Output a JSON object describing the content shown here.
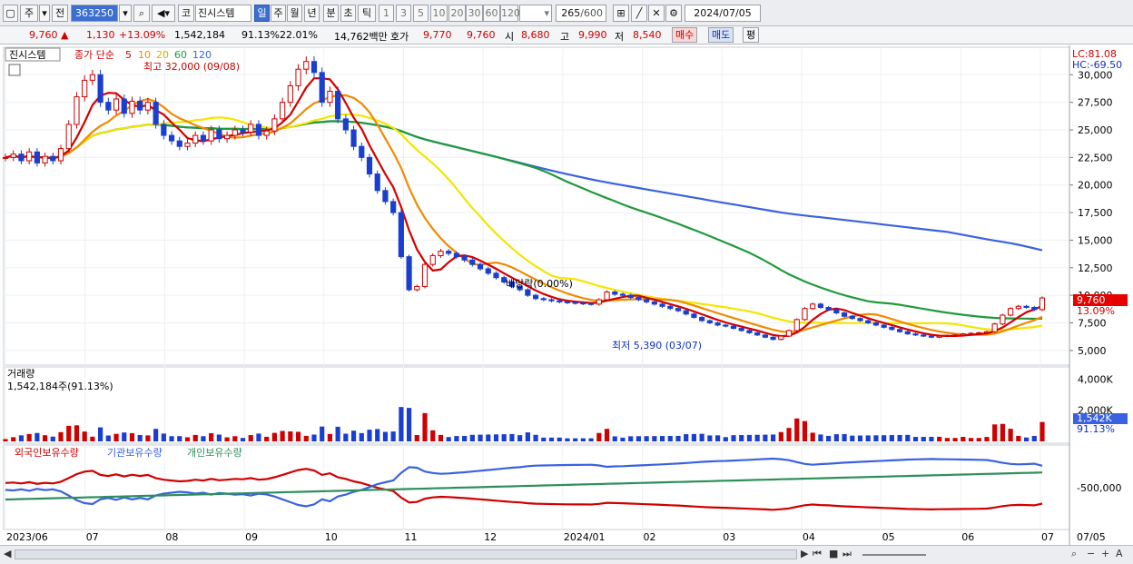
{
  "toolbar": {
    "period_labels": [
      "주",
      "전"
    ],
    "code": "363250",
    "code_type": "코",
    "stock_name": "진시스템",
    "timeframes": [
      "일",
      "주",
      "월",
      "년",
      "분",
      "초",
      "틱"
    ],
    "selected_timeframe": "일",
    "intervals": [
      "1",
      "3",
      "5",
      "10",
      "20",
      "30",
      "60",
      "120"
    ],
    "count": "265",
    "count_max": "/600",
    "date": "2024/07/05"
  },
  "quote": {
    "price": "9,760",
    "change_sign": "▲",
    "change": "1,130",
    "change_pct": "+13.09%",
    "volume": "1,542,184",
    "vol_ratio": "91.13%",
    "turnover": "22.01%",
    "amount": "14,762백만",
    "ask_label": "호가",
    "ask1": "9,770",
    "ask2": "9,760",
    "open_label": "시",
    "open": "8,680",
    "high_label": "고",
    "high": "9,990",
    "low_label": "저",
    "low": "8,540",
    "buy_label": "매수",
    "sell_label": "매도",
    "avg_label": "평"
  },
  "colors": {
    "up": "#d00000",
    "down": "#1a3fd0",
    "ma5": "#d40000",
    "ma10": "#f08a00",
    "ma20": "#f3e600",
    "ma60": "#1f9a3a",
    "ma120": "#3a62e0",
    "volume_up": "#d00000",
    "volume_down": "#1a3fd0",
    "foreign": "#d00000",
    "institution": "#3a62e0",
    "individual": "#2d8f5a"
  },
  "chart_data": [
    {
      "type": "candlestick",
      "title": "진시스템",
      "legend": {
        "prefix": "종가 단순",
        "periods": [
          "5",
          "10",
          "20",
          "60",
          "120"
        ]
      },
      "ylim": [
        4000,
        32000
      ],
      "yticks": [
        "30,000",
        "27,500",
        "25,000",
        "22,500",
        "20,000",
        "17,500",
        "15,000",
        "12,500",
        "10,000",
        "7,500",
        "5,000"
      ],
      "lc": "LC:81.08",
      "hc": "HC:-69.50",
      "annotations": {
        "high": "최고 32,000 (09/08)",
        "low": "최저 5,390 (03/07)",
        "dividend": "배당락(0.00%)"
      },
      "last_price_tag": "9,760",
      "last_pct_tag": "13.09%",
      "close_series": [
        22500,
        22800,
        22200,
        23000,
        22000,
        22600,
        22200,
        23300,
        25500,
        28000,
        29500,
        30000,
        27500,
        26800,
        27800,
        26500,
        27600,
        26800,
        27500,
        25500,
        24500,
        24000,
        23500,
        23800,
        24500,
        24000,
        25000,
        24200,
        24500,
        25000,
        24800,
        25500,
        24500,
        24900,
        26000,
        27500,
        29000,
        30500,
        31200,
        30200,
        27500,
        28500,
        26000,
        25000,
        23500,
        22500,
        21000,
        19500,
        18500,
        17500,
        13500,
        10500,
        10800,
        12800,
        13600,
        14000,
        13800,
        13500,
        13200,
        12800,
        12400,
        12000,
        11600,
        11200,
        10800,
        10500,
        10000,
        9700,
        9600,
        9500,
        9400,
        9350,
        9300,
        9250,
        9200,
        9600,
        10300,
        10100,
        10000,
        9800,
        9600,
        9400,
        9200,
        9000,
        8800,
        8600,
        8300,
        8000,
        7700,
        7500,
        7300,
        7200,
        7000,
        6800,
        6600,
        6400,
        6200,
        6000,
        6300,
        6800,
        7800,
        8800,
        9200,
        8900,
        8700,
        8400,
        8100,
        7900,
        7700,
        7500,
        7300,
        7100,
        6900,
        6700,
        6500,
        6400,
        6300,
        6200,
        6300,
        6350,
        6400,
        6500,
        6550,
        6600,
        6700,
        7400,
        8200,
        8800,
        9000,
        8900,
        8700,
        9760
      ],
      "volume": {
        "label": "거래량",
        "value_text": "1,542,184주(91.13%)",
        "ylim": [
          0,
          4200000
        ],
        "yticks": [
          "4,000K",
          "2,000K"
        ],
        "last_tag": "1,542K",
        "last_pct": "91.13%"
      },
      "holdings": {
        "labels": [
          "외국인보유수량",
          "기관보유수량",
          "개인보유수량"
        ],
        "ytick": "-500,000"
      },
      "x_ticks": [
        "2023/06",
        "07",
        "08",
        "09",
        "10",
        "11",
        "12",
        "2024/01",
        "02",
        "03",
        "04",
        "05",
        "06",
        "07",
        "07/05"
      ]
    }
  ],
  "bottombar": {
    "nav_icons": [
      "play-icon",
      "rewind-icon",
      "forward-icon",
      "stop-icon",
      "pause-icon",
      "zoom-icon",
      "zoom-out-icon",
      "zoom-in-icon"
    ]
  }
}
